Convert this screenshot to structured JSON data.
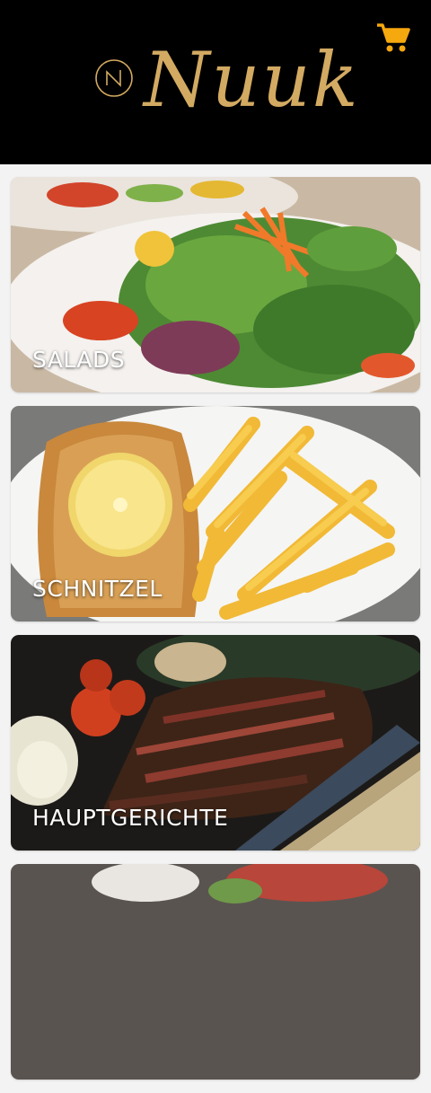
{
  "app": {
    "brand": "Nuuk"
  },
  "header": {
    "cart_icon": "shopping-cart-icon",
    "accent_color": "#f6a80f",
    "logo_color": "#d3aa62"
  },
  "categories": [
    {
      "label": "SALADS"
    },
    {
      "label": "SCHNITZEL"
    },
    {
      "label": "HAUPTGERICHTE"
    },
    {
      "label": ""
    }
  ]
}
